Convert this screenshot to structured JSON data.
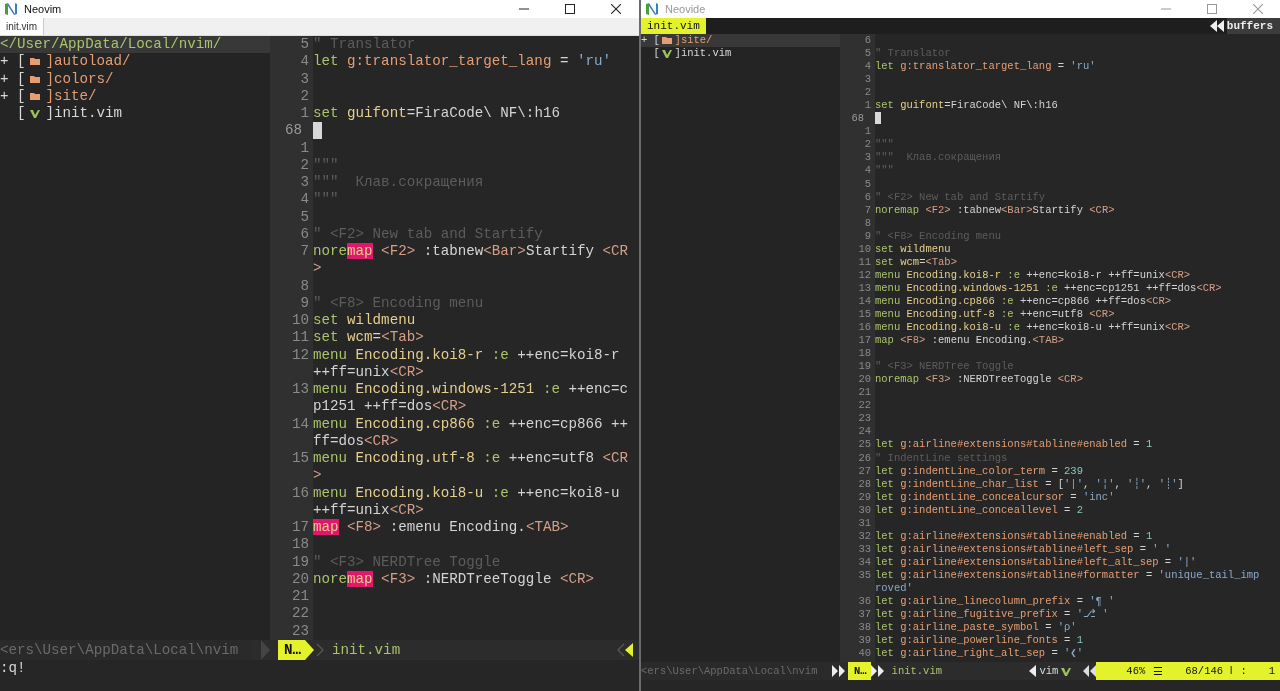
{
  "windows": [
    {
      "kind": "neovim",
      "title": "Neovim",
      "focused": true,
      "tabs": [
        {
          "label": "init.vim",
          "selected": true
        }
      ],
      "tree": [
        {
          "kind": "root",
          "label": "</User/AppData/Local/nvim/",
          "selected": true
        },
        {
          "kind": "folder",
          "expander": "+",
          "bracket": "[",
          "label": "]autoload/",
          "selected": false
        },
        {
          "kind": "folder",
          "expander": "+",
          "bracket": "[",
          "label": "]colors/",
          "selected": false
        },
        {
          "kind": "folder",
          "expander": "+",
          "bracket": "[",
          "label": "]site/",
          "selected": false
        },
        {
          "kind": "file",
          "bracket": "[",
          "label": "]init.vim",
          "selected": false
        }
      ],
      "code": [
        {
          "number": "5",
          "current": false,
          "tokens": [
            {
              "text": "\" Translator",
              "kind": "cmt"
            }
          ]
        },
        {
          "number": "4",
          "current": false,
          "tokens": [
            {
              "text": "let",
              "kind": "kw"
            },
            {
              "text": " g:translator_target_lang",
              "kind": "var"
            },
            {
              "text": " = ",
              "kind": "text"
            },
            {
              "text": "'ru'",
              "kind": "str"
            }
          ]
        },
        {
          "number": "3",
          "current": false
        },
        {
          "number": "2",
          "current": false
        },
        {
          "number": "1",
          "current": false,
          "tokens": [
            {
              "text": "set",
              "kind": "kw"
            },
            {
              "text": " guifont",
              "kind": "opt"
            },
            {
              "text": "=FiraCode\\ NF\\:h16",
              "kind": "text"
            }
          ]
        },
        {
          "number": "68",
          "current": true
        },
        {
          "number": "1",
          "current": false
        },
        {
          "number": "2",
          "current": false,
          "tokens": [
            {
              "text": "\"\"\"",
              "kind": "cmt"
            }
          ]
        },
        {
          "number": "3",
          "current": false,
          "tokens": [
            {
              "text": "\"\"\"  Клав.сокращения",
              "kind": "cmt"
            }
          ]
        },
        {
          "number": "4",
          "current": false,
          "tokens": [
            {
              "text": "\"\"\"",
              "kind": "cmt"
            }
          ]
        },
        {
          "number": "5",
          "current": false
        },
        {
          "number": "6",
          "current": false,
          "tokens": [
            {
              "text": "\" <F2> New tab and Startify",
              "kind": "cmt"
            }
          ]
        },
        {
          "number": "7",
          "current": false,
          "tokens": [
            {
              "text": "nore",
              "kind": "kw"
            },
            {
              "text": "map",
              "kind": "match"
            },
            {
              "text": " <F2>",
              "kind": "key"
            },
            {
              "text": " :tabnew",
              "kind": "text"
            },
            {
              "text": "<Bar>",
              "kind": "key"
            },
            {
              "text": "Startify ",
              "kind": "text"
            },
            {
              "text": "<CR",
              "kind": "key"
            }
          ]
        },
        {
          "tokens": [
            {
              "text": ">",
              "kind": "key"
            }
          ]
        },
        {
          "number": "8",
          "current": false
        },
        {
          "number": "9",
          "current": false,
          "tokens": [
            {
              "text": "\" <F8> Encoding menu",
              "kind": "cmt"
            }
          ]
        },
        {
          "number": "10",
          "current": false,
          "tokens": [
            {
              "text": "set",
              "kind": "kw"
            },
            {
              "text": " wildmenu",
              "kind": "opt"
            }
          ]
        },
        {
          "number": "11",
          "current": false,
          "tokens": [
            {
              "text": "set",
              "kind": "kw"
            },
            {
              "text": " wcm",
              "kind": "opt"
            },
            {
              "text": "=",
              "kind": "text"
            },
            {
              "text": "<Tab>",
              "kind": "key"
            }
          ]
        },
        {
          "number": "12",
          "current": false,
          "tokens": [
            {
              "text": "menu",
              "kind": "kw"
            },
            {
              "text": " Encoding.koi8-r",
              "kind": "opt"
            },
            {
              "text": " :e",
              "kind": "kw"
            },
            {
              "text": " ++enc=koi8-r",
              "kind": "text"
            }
          ]
        },
        {
          "tokens": [
            {
              "text": "++ff=unix",
              "kind": "text"
            },
            {
              "text": "<CR>",
              "kind": "key"
            }
          ]
        },
        {
          "number": "13",
          "current": false,
          "tokens": [
            {
              "text": "menu",
              "kind": "kw"
            },
            {
              "text": " Encoding.windows-1251",
              "kind": "opt"
            },
            {
              "text": " :e",
              "kind": "kw"
            },
            {
              "text": " ++enc=c",
              "kind": "text"
            }
          ]
        },
        {
          "tokens": [
            {
              "text": "p1251 ++ff=dos",
              "kind": "text"
            },
            {
              "text": "<CR>",
              "kind": "key"
            }
          ]
        },
        {
          "number": "14",
          "current": false,
          "tokens": [
            {
              "text": "menu",
              "kind": "kw"
            },
            {
              "text": " Encoding.cp866",
              "kind": "opt"
            },
            {
              "text": " :e",
              "kind": "kw"
            },
            {
              "text": " ++enc=cp866 ++",
              "kind": "text"
            }
          ]
        },
        {
          "tokens": [
            {
              "text": "ff=dos",
              "kind": "text"
            },
            {
              "text": "<CR>",
              "kind": "key"
            }
          ]
        },
        {
          "number": "15",
          "current": false,
          "tokens": [
            {
              "text": "menu",
              "kind": "kw"
            },
            {
              "text": " Encoding.utf-8",
              "kind": "opt"
            },
            {
              "text": " :e",
              "kind": "kw"
            },
            {
              "text": " ++enc=utf8 ",
              "kind": "text"
            },
            {
              "text": "<CR",
              "kind": "key"
            }
          ]
        },
        {
          "tokens": [
            {
              "text": ">",
              "kind": "key"
            }
          ]
        },
        {
          "number": "16",
          "current": false,
          "tokens": [
            {
              "text": "menu",
              "kind": "kw"
            },
            {
              "text": " Encoding.koi8-u",
              "kind": "opt"
            },
            {
              "text": " :e",
              "kind": "kw"
            },
            {
              "text": " ++enc=koi8-u",
              "kind": "text"
            }
          ]
        },
        {
          "tokens": [
            {
              "text": "++ff=unix",
              "kind": "text"
            },
            {
              "text": "<CR>",
              "kind": "key"
            }
          ]
        },
        {
          "number": "17",
          "current": false,
          "tokens": [
            {
              "text": "map",
              "kind": "match"
            },
            {
              "text": " <F8>",
              "kind": "key"
            },
            {
              "text": " :emenu Encoding.",
              "kind": "text"
            },
            {
              "text": "<TAB>",
              "kind": "key"
            }
          ]
        },
        {
          "number": "18",
          "current": false
        },
        {
          "number": "19",
          "current": false,
          "tokens": [
            {
              "text": "\" <F3> NERDTree Toggle",
              "kind": "cmt"
            }
          ]
        },
        {
          "number": "20",
          "current": false,
          "tokens": [
            {
              "text": "nore",
              "kind": "kw"
            },
            {
              "text": "map",
              "kind": "match"
            },
            {
              "text": " <F3>",
              "kind": "key"
            },
            {
              "text": " :NERDTreeToggle ",
              "kind": "text"
            },
            {
              "text": "<CR>",
              "kind": "key"
            }
          ]
        },
        {
          "number": "21",
          "current": false
        },
        {
          "number": "22",
          "current": false
        },
        {
          "number": "23",
          "current": false
        }
      ],
      "statusline": {
        "path": "<ers\\User\\AppData\\Local\\nvim",
        "mode": "N…",
        "file": "init.vim"
      },
      "cmdline": ":q!"
    },
    {
      "kind": "neovide",
      "title": "Neovide",
      "focused": false,
      "tabs": [
        {
          "label": "init.vim",
          "selected": true
        }
      ],
      "buffers_label": "buffers",
      "tree": [
        {
          "kind": "folder",
          "expander": "+",
          "bracket": "[",
          "label": "]site/",
          "selected": true
        },
        {
          "kind": "file",
          "bracket": "[",
          "label": "]init.vim",
          "selected": false
        }
      ],
      "code": [
        {
          "number": "6",
          "current": false
        },
        {
          "number": "5",
          "current": false,
          "tokens": [
            {
              "text": "\" Translator",
              "kind": "cmt"
            }
          ]
        },
        {
          "number": "4",
          "current": false,
          "tokens": [
            {
              "text": "let",
              "kind": "kw"
            },
            {
              "text": " g:translator_target_lang",
              "kind": "var"
            },
            {
              "text": " = ",
              "kind": "text"
            },
            {
              "text": "'ru'",
              "kind": "str"
            }
          ]
        },
        {
          "number": "3",
          "current": false
        },
        {
          "number": "2",
          "current": false
        },
        {
          "number": "1",
          "current": false,
          "tokens": [
            {
              "text": "set",
              "kind": "kw"
            },
            {
              "text": " guifont",
              "kind": "opt"
            },
            {
              "text": "=FiraCode\\ NF\\:h16",
              "kind": "text"
            }
          ]
        },
        {
          "number": "68",
          "current": true
        },
        {
          "number": "1",
          "current": false
        },
        {
          "number": "2",
          "current": false,
          "tokens": [
            {
              "text": "\"\"\"",
              "kind": "cmt"
            }
          ]
        },
        {
          "number": "3",
          "current": false,
          "tokens": [
            {
              "text": "\"\"\"  Клав.сокращения",
              "kind": "cmt"
            }
          ]
        },
        {
          "number": "4",
          "current": false,
          "tokens": [
            {
              "text": "\"\"\"",
              "kind": "cmt"
            }
          ]
        },
        {
          "number": "5",
          "current": false
        },
        {
          "number": "6",
          "current": false,
          "tokens": [
            {
              "text": "\" <F2> New tab and Startify",
              "kind": "cmt"
            }
          ]
        },
        {
          "number": "7",
          "current": false,
          "tokens": [
            {
              "text": "noremap",
              "kind": "kw"
            },
            {
              "text": " <F2>",
              "kind": "key"
            },
            {
              "text": " :tabnew",
              "kind": "text"
            },
            {
              "text": "<Bar>",
              "kind": "key"
            },
            {
              "text": "Startify ",
              "kind": "text"
            },
            {
              "text": "<CR>",
              "kind": "key"
            }
          ]
        },
        {
          "number": "8",
          "current": false
        },
        {
          "number": "9",
          "current": false,
          "tokens": [
            {
              "text": "\" <F8> Encoding menu",
              "kind": "cmt"
            }
          ]
        },
        {
          "number": "10",
          "current": false,
          "tokens": [
            {
              "text": "set",
              "kind": "kw"
            },
            {
              "text": " wildmenu",
              "kind": "opt"
            }
          ]
        },
        {
          "number": "11",
          "current": false,
          "tokens": [
            {
              "text": "set",
              "kind": "kw"
            },
            {
              "text": " wcm",
              "kind": "opt"
            },
            {
              "text": "=",
              "kind": "text"
            },
            {
              "text": "<Tab>",
              "kind": "key"
            }
          ]
        },
        {
          "number": "12",
          "current": false,
          "tokens": [
            {
              "text": "menu",
              "kind": "kw"
            },
            {
              "text": " Encoding.koi8-r",
              "kind": "opt"
            },
            {
              "text": " :e",
              "kind": "kw"
            },
            {
              "text": " ++enc=koi8-r ++ff=unix",
              "kind": "text"
            },
            {
              "text": "<CR>",
              "kind": "key"
            }
          ]
        },
        {
          "number": "13",
          "current": false,
          "tokens": [
            {
              "text": "menu",
              "kind": "kw"
            },
            {
              "text": " Encoding.windows-1251",
              "kind": "opt"
            },
            {
              "text": " :e",
              "kind": "kw"
            },
            {
              "text": " ++enc=cp1251 ++ff=dos",
              "kind": "text"
            },
            {
              "text": "<CR>",
              "kind": "key"
            }
          ]
        },
        {
          "number": "14",
          "current": false,
          "tokens": [
            {
              "text": "menu",
              "kind": "kw"
            },
            {
              "text": " Encoding.cp866",
              "kind": "opt"
            },
            {
              "text": " :e",
              "kind": "kw"
            },
            {
              "text": " ++enc=cp866 ++ff=dos",
              "kind": "text"
            },
            {
              "text": "<CR>",
              "kind": "key"
            }
          ]
        },
        {
          "number": "15",
          "current": false,
          "tokens": [
            {
              "text": "menu",
              "kind": "kw"
            },
            {
              "text": " Encoding.utf-8",
              "kind": "opt"
            },
            {
              "text": " :e",
              "kind": "kw"
            },
            {
              "text": " ++enc=utf8 ",
              "kind": "text"
            },
            {
              "text": "<CR>",
              "kind": "key"
            }
          ]
        },
        {
          "number": "16",
          "current": false,
          "tokens": [
            {
              "text": "menu",
              "kind": "kw"
            },
            {
              "text": " Encoding.koi8-u",
              "kind": "opt"
            },
            {
              "text": " :e",
              "kind": "kw"
            },
            {
              "text": " ++enc=koi8-u ++ff=unix",
              "kind": "text"
            },
            {
              "text": "<CR>",
              "kind": "key"
            }
          ]
        },
        {
          "number": "17",
          "current": false,
          "tokens": [
            {
              "text": "map",
              "kind": "kw"
            },
            {
              "text": " <F8>",
              "kind": "key"
            },
            {
              "text": " :emenu Encoding.",
              "kind": "text"
            },
            {
              "text": "<TAB>",
              "kind": "key"
            }
          ]
        },
        {
          "number": "18",
          "current": false
        },
        {
          "number": "19",
          "current": false,
          "tokens": [
            {
              "text": "\" <F3> NERDTree Toggle",
              "kind": "cmt"
            }
          ]
        },
        {
          "number": "20",
          "current": false,
          "tokens": [
            {
              "text": "noremap",
              "kind": "kw"
            },
            {
              "text": " <F3>",
              "kind": "key"
            },
            {
              "text": " :NERDTreeToggle ",
              "kind": "text"
            },
            {
              "text": "<CR>",
              "kind": "key"
            }
          ]
        },
        {
          "number": "21",
          "current": false
        },
        {
          "number": "22",
          "current": false
        },
        {
          "number": "23",
          "current": false
        },
        {
          "number": "24",
          "current": false
        },
        {
          "number": "25",
          "current": false,
          "tokens": [
            {
              "text": "let",
              "kind": "kw"
            },
            {
              "text": " g:airline#extensions#tabline#enabled",
              "kind": "var"
            },
            {
              "text": " = ",
              "kind": "text"
            },
            {
              "text": "1",
              "kind": "num"
            }
          ]
        },
        {
          "number": "26",
          "current": false,
          "tokens": [
            {
              "text": "\" IndentLine settings",
              "kind": "cmt"
            }
          ]
        },
        {
          "number": "27",
          "current": false,
          "tokens": [
            {
              "text": "let",
              "kind": "kw"
            },
            {
              "text": " g:indentLine_color_term",
              "kind": "var"
            },
            {
              "text": " = ",
              "kind": "text"
            },
            {
              "text": "239",
              "kind": "num"
            }
          ]
        },
        {
          "number": "28",
          "current": false,
          "tokens": [
            {
              "text": "let",
              "kind": "kw"
            },
            {
              "text": " g:indentLine_char_list",
              "kind": "var"
            },
            {
              "text": " = [",
              "kind": "text"
            },
            {
              "text": "'|'",
              "kind": "str"
            },
            {
              "text": ", ",
              "kind": "text"
            },
            {
              "text": "'¦'",
              "kind": "str"
            },
            {
              "text": ", ",
              "kind": "text"
            },
            {
              "text": "'┆'",
              "kind": "str"
            },
            {
              "text": ", ",
              "kind": "text"
            },
            {
              "text": "'┊'",
              "kind": "str"
            },
            {
              "text": "]",
              "kind": "text"
            }
          ]
        },
        {
          "number": "29",
          "current": false,
          "tokens": [
            {
              "text": "let",
              "kind": "kw"
            },
            {
              "text": " g:indentLine_concealcursor",
              "kind": "var"
            },
            {
              "text": " = ",
              "kind": "text"
            },
            {
              "text": "'inc'",
              "kind": "str"
            }
          ]
        },
        {
          "number": "30",
          "current": false,
          "tokens": [
            {
              "text": "let",
              "kind": "kw"
            },
            {
              "text": " g:indentLine_conceallevel",
              "kind": "var"
            },
            {
              "text": " = ",
              "kind": "text"
            },
            {
              "text": "2",
              "kind": "num"
            }
          ]
        },
        {
          "number": "31",
          "current": false
        },
        {
          "number": "32",
          "current": false,
          "tokens": [
            {
              "text": "let",
              "kind": "kw"
            },
            {
              "text": " g:airline#extensions#tabline#enabled",
              "kind": "var"
            },
            {
              "text": " = ",
              "kind": "text"
            },
            {
              "text": "1",
              "kind": "num"
            }
          ]
        },
        {
          "number": "33",
          "current": false,
          "tokens": [
            {
              "text": "let",
              "kind": "kw"
            },
            {
              "text": " g:airline#extensions#tabline#left_sep",
              "kind": "var"
            },
            {
              "text": " = ",
              "kind": "text"
            },
            {
              "text": "' '",
              "kind": "str"
            }
          ]
        },
        {
          "number": "34",
          "current": false,
          "tokens": [
            {
              "text": "let",
              "kind": "kw"
            },
            {
              "text": " g:airline#extensions#tabline#left_alt_sep",
              "kind": "var"
            },
            {
              "text": " = ",
              "kind": "text"
            },
            {
              "text": "'|'",
              "kind": "str"
            }
          ]
        },
        {
          "number": "35",
          "current": false,
          "tokens": [
            {
              "text": "let",
              "kind": "kw"
            },
            {
              "text": " g:airline#extensions#tabline#formatter",
              "kind": "var"
            },
            {
              "text": " = ",
              "kind": "text"
            },
            {
              "text": "'unique_tail_imp",
              "kind": "str"
            }
          ]
        },
        {
          "tokens": [
            {
              "text": "roved'",
              "kind": "str"
            }
          ]
        },
        {
          "number": "36",
          "current": false,
          "tokens": [
            {
              "text": "let",
              "kind": "kw"
            },
            {
              "text": " g:airline_linecolumn_prefix",
              "kind": "var"
            },
            {
              "text": " = ",
              "kind": "text"
            },
            {
              "text": "'¶ '",
              "kind": "str"
            }
          ]
        },
        {
          "number": "37",
          "current": false,
          "tokens": [
            {
              "text": "let",
              "kind": "kw"
            },
            {
              "text": " g:airline_fugitive_prefix",
              "kind": "var"
            },
            {
              "text": " = ",
              "kind": "text"
            },
            {
              "text": "'⎇ '",
              "kind": "str"
            }
          ]
        },
        {
          "number": "38",
          "current": false,
          "tokens": [
            {
              "text": "let",
              "kind": "kw"
            },
            {
              "text": " g:airline_paste_symbol",
              "kind": "var"
            },
            {
              "text": " = ",
              "kind": "text"
            },
            {
              "text": "'ρ'",
              "kind": "str"
            }
          ]
        },
        {
          "number": "39",
          "current": false,
          "tokens": [
            {
              "text": "let",
              "kind": "kw"
            },
            {
              "text": " g:airline_powerline_fonts",
              "kind": "var"
            },
            {
              "text": " = ",
              "kind": "text"
            },
            {
              "text": "1",
              "kind": "num"
            }
          ]
        },
        {
          "number": "40",
          "current": false,
          "tokens": [
            {
              "text": "let",
              "kind": "kw"
            },
            {
              "text": " g:airline_right_alt_sep",
              "kind": "var"
            },
            {
              "text": " = ",
              "kind": "text"
            },
            {
              "text": "'❮'",
              "kind": "str"
            }
          ]
        }
      ],
      "statusline": {
        "path": "<ers\\User\\AppData\\Local\\nvim",
        "mode": "N…",
        "file": "init.vim",
        "filetype": "vim",
        "percent": "46%",
        "menu_symbol": "☰",
        "position": "68/146",
        "column_symbol": "ǀ",
        "column_label": ":",
        "column": "1"
      }
    }
  ]
}
